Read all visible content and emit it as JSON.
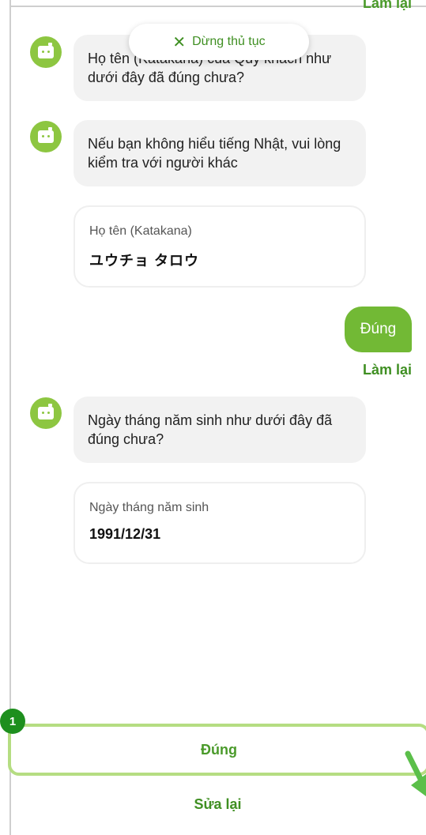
{
  "header": {
    "redo_top_partial": "Làm lại",
    "stop_label": "Dừng thủ tục"
  },
  "messages": {
    "bot1": "Họ tên (Katakana) của Quý khách như dưới đây đã đúng chưa?",
    "bot2": "Nếu bạn không hiểu tiếng Nhật, vui lòng kiểm tra với người khác",
    "card1": {
      "label": "Họ tên (Katakana)",
      "value": "ユウチョ タロウ"
    },
    "user_reply": "Đúng",
    "redo": "Làm lại",
    "bot3": "Ngày tháng năm sinh như dưới đây đã đúng chưa?",
    "card2": {
      "label": "Ngày tháng năm sinh",
      "value": "1991/12/31"
    }
  },
  "actions": {
    "badge": "1",
    "yes_label": "Đúng",
    "fix_label": "Sửa lại"
  },
  "colors": {
    "brand_green": "#72b935",
    "link_green": "#3f8f22",
    "avatar_green": "#8dc641",
    "highlight_border": "#b5dd82",
    "badge_green": "#1e8f1e"
  }
}
